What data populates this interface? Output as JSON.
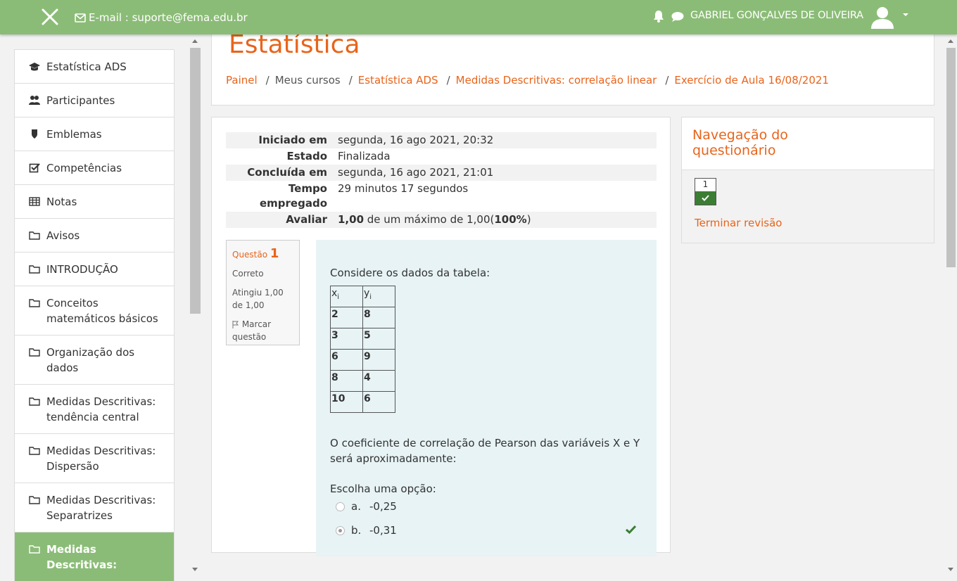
{
  "topbar": {
    "email_label": "E-mail : suporte@fema.edu.br",
    "user_name": "GABRIEL GONÇALVES DE OLIVEIRA",
    "bar_color": "#8bbc77"
  },
  "sidebar": {
    "items": [
      {
        "label": "Estatística ADS",
        "icon": "graduation-cap-icon"
      },
      {
        "label": "Participantes",
        "icon": "users-icon"
      },
      {
        "label": "Emblemas",
        "icon": "shield-icon"
      },
      {
        "label": "Competências",
        "icon": "checkbox-icon"
      },
      {
        "label": "Notas",
        "icon": "table-icon"
      },
      {
        "label": "Avisos",
        "icon": "folder-icon"
      },
      {
        "label": "INTRODUÇÃO",
        "icon": "folder-icon"
      },
      {
        "label": "Conceitos matemáticos básicos",
        "icon": "folder-icon"
      },
      {
        "label": "Organização dos dados",
        "icon": "folder-icon"
      },
      {
        "label": "Medidas Descritivas: tendência central",
        "icon": "folder-icon"
      },
      {
        "label": "Medidas Descritivas: Dispersão",
        "icon": "folder-icon"
      },
      {
        "label": "Medidas Descritivas: Separatrizes",
        "icon": "folder-icon"
      },
      {
        "label": "Medidas Descritivas:",
        "icon": "folder-icon",
        "active": true
      }
    ]
  },
  "header": {
    "course_title": "Estatística",
    "breadcrumb": [
      "Painel",
      "Meus cursos",
      "Estatística ADS",
      "Medidas Descritivas: correlação linear",
      "Exercício de Aula 16/08/2021"
    ]
  },
  "summary": {
    "rows": [
      {
        "label": "Iniciado em",
        "value": "segunda, 16 ago 2021, 20:32"
      },
      {
        "label": "Estado",
        "value": "Finalizada"
      },
      {
        "label": "Concluída em",
        "value": "segunda, 16 ago 2021, 21:01"
      },
      {
        "label": "Tempo empregado",
        "value": "29 minutos 17 segundos"
      }
    ],
    "grade_label": "Avaliar",
    "grade_value": "1,00",
    "grade_mid": " de um máximo de 1,00(",
    "grade_pct": "100%",
    "grade_end": ")"
  },
  "question": {
    "label": "Questão",
    "number": "1",
    "status": "Correto",
    "score": "Atingiu 1,00 de 1,00",
    "flag_label": "Marcar questão",
    "intro": "Considere os dados da tabela:",
    "table": {
      "x_header": "x",
      "y_header": "y",
      "sub": "i",
      "rows": [
        [
          "2",
          "8"
        ],
        [
          "3",
          "5"
        ],
        [
          "6",
          "9"
        ],
        [
          "8",
          "4"
        ],
        [
          "10",
          "6"
        ]
      ]
    },
    "prompt": "O coeficiente de correlação de Pearson das variáveis X e Y será aproximadamente:",
    "choose": "Escolha uma opção:",
    "options": [
      {
        "letter": "a.",
        "text": "-0,25",
        "checked": false
      },
      {
        "letter": "b.",
        "text": "-0,31",
        "checked": true
      }
    ]
  },
  "quiz_nav": {
    "title": "Navegação do questionário",
    "button_number": "1",
    "finish_label": "Terminar revisão"
  }
}
